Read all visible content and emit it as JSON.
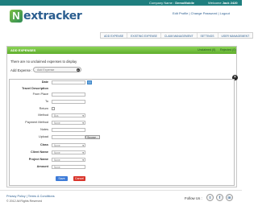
{
  "topbar": {
    "company_label": "Company Name :",
    "company_name": "DemoMobile",
    "welcome": "Welcome",
    "user": "Jack 2420"
  },
  "logo": {
    "first": "N",
    "rest": "extracker"
  },
  "top_links": {
    "edit_profile": "Edit Profile",
    "sep": "|",
    "change_password": "Change Password",
    "sep2": "|",
    "logout": "Logout"
  },
  "nav": {
    "items": [
      "ADD EXPENSE",
      "EXISTING EXPENSE",
      "CLAIM MANAGEMENT",
      "SETTINGS",
      "USER MANAGEMENT"
    ]
  },
  "panel": {
    "title": "ADD EXPENSES",
    "unclaimed": "Unclaimed (0)",
    "rejected": "Rejected (0)"
  },
  "messages": {
    "no_unclaimed": "There are no unclaimed expenses to display"
  },
  "add_expense": {
    "label": "Add Expense :",
    "placeholder": "Add Expense"
  },
  "form": {
    "date": "Date",
    "travel_description": "Travel Description",
    "from_place": "From Place",
    "to": "To",
    "return": "Return",
    "method": "Method",
    "method_value": "Bus",
    "payment_method": "Payment Method",
    "payment_value": "None",
    "notes": "Notes",
    "upload": "Upload",
    "browse": "Browse...",
    "class": "Class",
    "class_value": "None",
    "client_name": "Client Name",
    "client_value": "None",
    "project_name": "Project Name",
    "project_value": "None",
    "amount": "Amount",
    "amount_value": "None",
    "save": "Save",
    "cancel": "Cancel"
  },
  "footer": {
    "privacy": "Privacy Policy",
    "sep": "|",
    "terms": "Terms & Conditions",
    "copyright": "© 2012 All Rights Reserved",
    "follow": "Follow Us :",
    "social": [
      {
        "icon": "twitter-icon",
        "glyph": "t"
      },
      {
        "icon": "facebook-icon",
        "glyph": "f"
      },
      {
        "icon": "linkedin-icon",
        "glyph": "in"
      }
    ]
  },
  "colors": {
    "topbar": "#1f7f7f",
    "panel_header": "#6fbd3a",
    "save": "#3d7bd8",
    "cancel": "#d9342b"
  }
}
